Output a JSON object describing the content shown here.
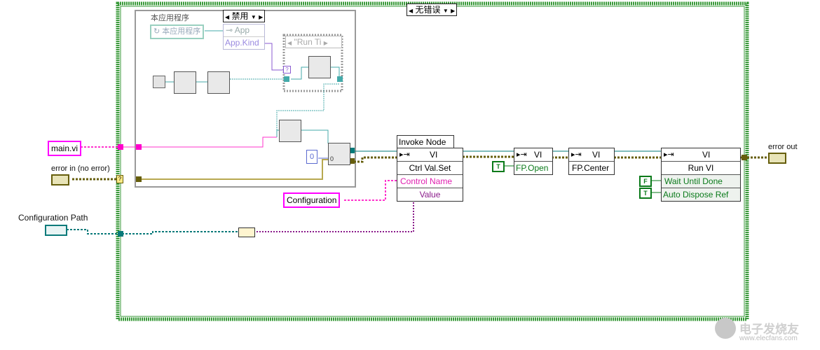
{
  "diagram": {
    "case_structure_outer": {
      "selector": "无错误"
    },
    "case_structure_inner": {
      "title": "本应用程序",
      "selector": "禁用"
    },
    "app_ref_constant": "本应用程序",
    "app_property_node": {
      "header": "App",
      "property": "App.Kind"
    },
    "run_ti_case": {
      "selector": "\"Run Ti"
    },
    "numeric_constant": "0",
    "select_value": "0"
  },
  "controls": {
    "main_vi": "main.vi",
    "error_in": "error in (no error)",
    "configuration_path": "Configuration Path",
    "configuration": "Configuration",
    "error_out": "error out"
  },
  "invoke_nodes": {
    "ctrl_val_set": {
      "label": "Invoke Node",
      "class": "VI",
      "method": "Ctrl Val.Set",
      "params": [
        "Control Name",
        "Value"
      ]
    },
    "fp_open": {
      "class": "VI",
      "method": "FP.Open",
      "bool_const": "T"
    },
    "fp_center": {
      "class": "VI",
      "method": "FP.Center"
    },
    "run_vi": {
      "class": "VI",
      "method": "Run VI",
      "params": [
        "Wait Until Done",
        "Auto Dispose Ref"
      ],
      "bool_consts": [
        "F",
        "T"
      ]
    }
  },
  "watermark": {
    "text_cn": "电子发烧友",
    "url": "www.elecfans.com"
  },
  "colors": {
    "structure_green": "#3a9a3a",
    "string_pink": "#ff33cc",
    "refnum_teal": "#007a7a",
    "error_cluster": "#7a6a0a",
    "path_teal": "#0a7a7a",
    "variant_purple": "#8a1a8a"
  }
}
